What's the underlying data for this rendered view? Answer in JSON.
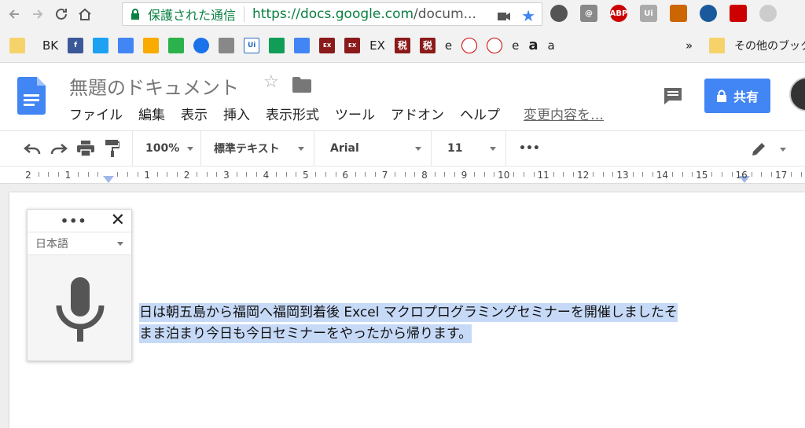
{
  "browser": {
    "secure_label": "保護された通信",
    "url_main": "https://docs.google.com",
    "url_rest": "/docum...",
    "extensions": [
      "evernote-icon",
      "at-icon",
      "ABP",
      "Ui",
      "bird-icon",
      "diamond-icon",
      "pdf-icon",
      "circle-icon"
    ]
  },
  "bookmarks": {
    "items": [
      "BK",
      "",
      "",
      "",
      "",
      "",
      "",
      "Ui",
      "",
      "",
      "EX",
      "EX",
      "EX",
      "税",
      "税",
      "e",
      "",
      "",
      "e",
      "a",
      "a"
    ],
    "more": "»",
    "other": "その他のブック"
  },
  "docs": {
    "title": "無題のドキュメント",
    "menu": [
      "ファイル",
      "編集",
      "表示",
      "挿入",
      "表示形式",
      "ツール",
      "アドオン",
      "ヘルプ"
    ],
    "changes": "変更内容を…",
    "share_label": "共有"
  },
  "toolbar": {
    "zoom": "100%",
    "style": "標準テキスト",
    "font": "Arial",
    "size": "11",
    "more": "•••"
  },
  "ruler": {
    "numbers": [
      "2",
      "1",
      "",
      "1",
      "2",
      "3",
      "4",
      "5",
      "6",
      "7",
      "8",
      "9",
      "10",
      "11",
      "12",
      "13",
      "14",
      "15",
      "16",
      "17"
    ]
  },
  "document": {
    "line1": "日は朝五島から福岡へ福岡到着後 Excel マクロプログラミングセミナーを開催しましたそ",
    "line2": "まま泊まり今日も今日セミナーをやったから帰ります。"
  },
  "voice": {
    "dots": "•••",
    "close": "✕",
    "language": "日本語"
  },
  "colors": {
    "accent": "#4285f4",
    "secure": "#0b8043",
    "highlight": "#c6d9f7"
  }
}
